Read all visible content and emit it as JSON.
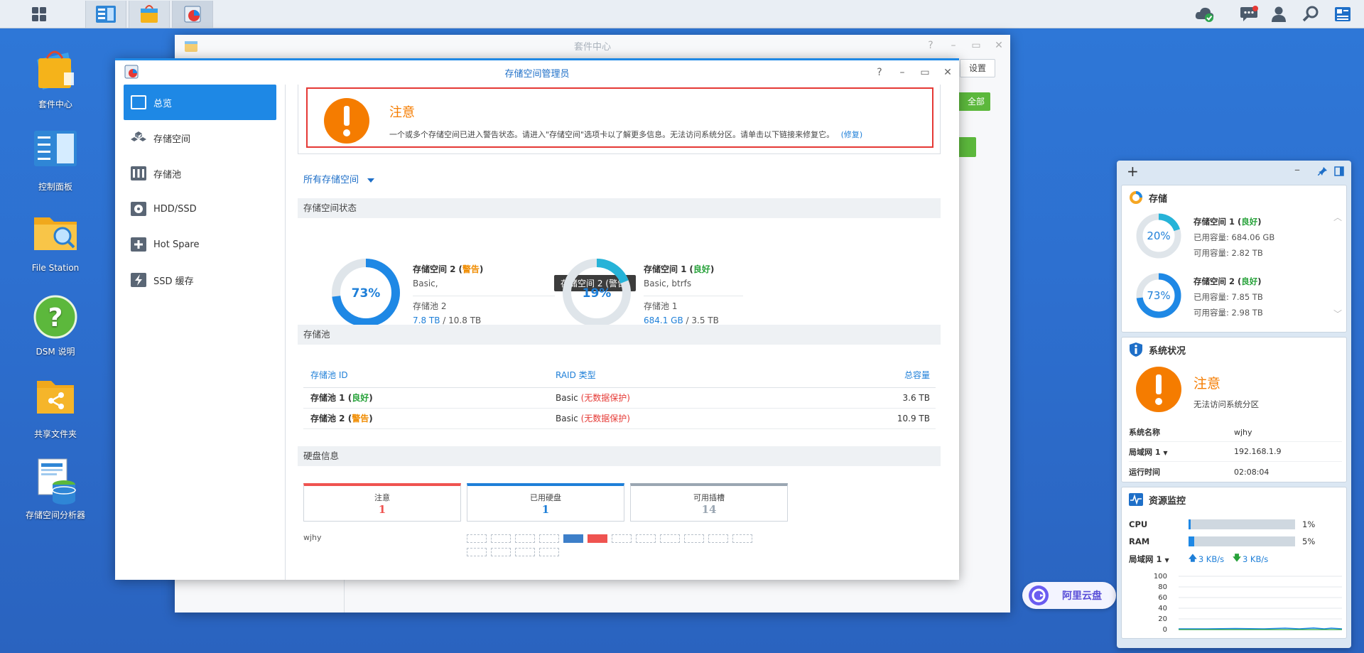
{
  "taskbar": {
    "apps": [
      "main-menu",
      "control-panel",
      "package-center",
      "storage-manager"
    ]
  },
  "desktop": {
    "icons": [
      {
        "label": "套件中心",
        "icon": "package-center-icon"
      },
      {
        "label": "控制面板",
        "icon": "control-panel-icon"
      },
      {
        "label": "File Station",
        "icon": "file-station-icon"
      },
      {
        "label": "DSM 说明",
        "icon": "help-icon"
      },
      {
        "label": "共享文件夹",
        "icon": "shared-folder-icon"
      },
      {
        "label": "存储空间分析器",
        "icon": "storage-analyzer-icon"
      }
    ]
  },
  "package_center": {
    "title": "套件中心",
    "settings": "设置",
    "all": "全部"
  },
  "storage_manager": {
    "title": "存储空间管理员",
    "nav": [
      "总览",
      "存储空间",
      "存储池",
      "HDD/SSD",
      "Hot Spare",
      "SSD 缓存"
    ],
    "alert": {
      "title": "注意",
      "message": "一个或多个存储空间已进入警告状态。请进入\"存储空间\"选项卡以了解更多信息。无法访问系统分区。请单击以下链接来修复它。",
      "link": "(修复)"
    },
    "filter": "所有存储空间",
    "volume_status_title": "存储空间状态",
    "volumes": [
      {
        "name": "存储空间 2",
        "status": "警告",
        "percent": 73,
        "percent_label": "73%",
        "type": "Basic,",
        "pool": "存储池 2",
        "used": "7.8 TB",
        "total": "/ 10.8 TB"
      },
      {
        "name": "存储空间 1",
        "status": "良好",
        "percent": 19,
        "percent_label": "19%",
        "type": "Basic, btrfs",
        "pool": "存储池 1",
        "used": "684.1 GB",
        "total": "/ 3.5 TB"
      }
    ],
    "tooltip": "存储空间 2 (警告)",
    "pool_title": "存储池",
    "pool_headers": [
      "存储池 ID",
      "RAID 类型",
      "总容量"
    ],
    "pools": [
      {
        "id": "存储池 1",
        "status": "良好",
        "raid": "Basic",
        "protect": "(无数据保护)",
        "capacity": "3.6 TB"
      },
      {
        "id": "存储池 2",
        "status": "警告",
        "raid": "Basic",
        "protect": "(无数据保护)",
        "capacity": "10.9 TB"
      }
    ],
    "disk_title": "硬盘信息",
    "disk_cards": [
      {
        "label": "注意",
        "value": "1",
        "color": "#ef5350"
      },
      {
        "label": "已用硬盘",
        "value": "1",
        "color": "#1e7fd8"
      },
      {
        "label": "可用插槽",
        "value": "14",
        "color": "#9aa6b2"
      }
    ],
    "host": "wjhy"
  },
  "aliyun": {
    "label": "阿里云盘"
  },
  "widgets": {
    "storage": {
      "title": "存储",
      "items": [
        {
          "name": "存储空间 1",
          "status": "良好",
          "percent": 20,
          "percent_label": "20%",
          "used_label": "已用容量:",
          "used": "684.06 GB",
          "free_label": "可用容量:",
          "free": "2.82 TB"
        },
        {
          "name": "存储空间 2",
          "status": "良好",
          "percent": 73,
          "percent_label": "73%",
          "used_label": "已用容量:",
          "used": "7.85 TB",
          "free_label": "可用容量:",
          "free": "2.98 TB"
        }
      ]
    },
    "system": {
      "title": "系统状况",
      "status": "注意",
      "message": "无法访问系统分区",
      "rows": [
        {
          "label": "系统名称",
          "value": "wjhy"
        },
        {
          "label": "局域网 1",
          "value": "192.168.1.9"
        },
        {
          "label": "运行时间",
          "value": "02:08:04"
        }
      ]
    },
    "resource": {
      "title": "资源监控",
      "cpu_label": "CPU",
      "cpu": 1,
      "cpu_text": "1%",
      "ram_label": "RAM",
      "ram": 5,
      "ram_text": "5%",
      "lan_label": "局域网 1",
      "up": "3 KB/s",
      "down": "3 KB/s",
      "y_ticks": [
        "100",
        "80",
        "60",
        "40",
        "20",
        "0"
      ]
    }
  }
}
